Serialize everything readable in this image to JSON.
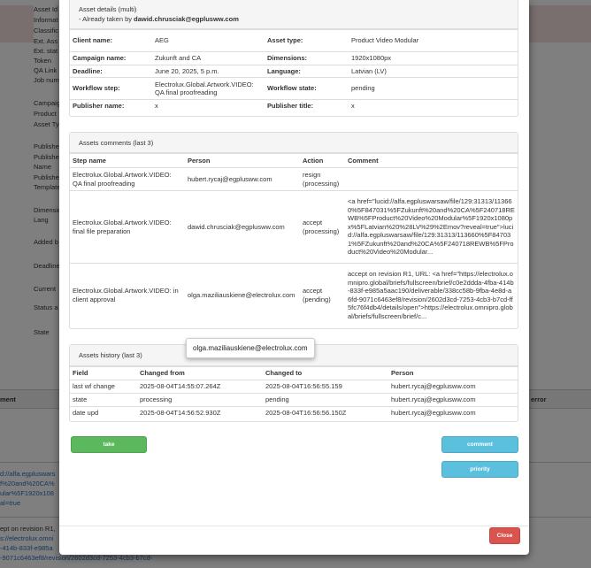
{
  "background": {
    "labels": [
      "Asset Id",
      "Informat",
      "Classific",
      "Ext. Ass",
      "Ext. stat",
      "Token",
      "QA Link",
      "Job num",
      "Campaig",
      "Product",
      "Asset Ty",
      "Publishe",
      "Publishe",
      "Name",
      "Publishe",
      "Template",
      "Dimensio",
      "Lang",
      "Added b",
      "Deadline",
      "Current",
      "Status a",
      "State"
    ],
    "table_headers": {
      "left": "ment",
      "right": "error"
    },
    "row1_lines": [
      "d://alfa.egpluswars",
      "f%20and%20CA%",
      "ular%5F1920x108",
      "al=true"
    ],
    "row2_lines": [
      "ept on revision R1,",
      "s://electrolux.omni",
      "-414b-833f-e985a",
      "-9071c6463ef8/revision/2602d3cd-7253-4cb3-b7cd-"
    ]
  },
  "details": {
    "title": "Asset details (multi)",
    "taken_prefix": "- Already taken by ",
    "taken_by": "dawid.chrusciak@egplusww.com",
    "rows": [
      {
        "k1": "Client name:",
        "v1": "AEG",
        "k2": "Asset type:",
        "v2": "Product Video Modular"
      },
      {
        "k1": "Campaign name:",
        "v1": "Zukunft and CA",
        "k2": "Dimensions:",
        "v2": "1920x1080px"
      },
      {
        "k1": "Deadline:",
        "v1": "June 20, 2025, 5 p.m.",
        "k2": "Language:",
        "v2": "Latvian (LV)"
      },
      {
        "k1": "Workflow step:",
        "v1": "Electrolux.Global.Artwork.VIDEO: QA final proofreading",
        "k2": "Workflow state:",
        "v2": "pending"
      },
      {
        "k1": "Publisher name:",
        "v1": "x",
        "k2": "Publisher title:",
        "v2": "x"
      }
    ]
  },
  "comments": {
    "title": "Assets comments (last 3)",
    "headers": [
      "Step name",
      "Person",
      "Action",
      "Comment"
    ],
    "rows": [
      {
        "step": "Electrolux.Global.Artwork.VIDEO: QA final proofreading",
        "person": "hubert.rycaj@egplusww.com",
        "action": "resign (processing)",
        "comment": ""
      },
      {
        "step": "Electrolux.Global.Artwork.VIDEO: final file preparation",
        "person": "dawid.chrusciak@egplusww.com",
        "action": "accept (processing)",
        "comment": "<a href=\"lucid://alfa.egpluswarsaw/file/129:31313/113660%5F847031%5FZukunft%20and%20CA%5F240718REWB%5FProduct%20Video%20Modular%5F1920x1080px%5FLatvian%20%28LV%29%2Emov?reveal=true\">lucid://alfa.egpluswarsaw/file/129:31313/113660%5F847031%5FZukunft%20and%20CA%5F240718REWB%5FProduct%20Video%20Modular..."
      },
      {
        "step": "Electrolux.Global.Artwork.VIDEO: in client approval",
        "person": "olga.maziliauskiene@electrolux.com",
        "action": "accept (pending)",
        "comment": "accept on revision R1, URL: <a href=\"https://electrolux.omnipro.global/briefs/fullscreen/brief/c0e2ddda-4fba-414b-833f-e985a5aac190/deliverable/338cc58b-9fba-4e8d-a6fd-9071c6463ef8/revision/2602d3cd-7253-4cb3-b7cd-ff5fc76f4db4/details/open\">https://electrolux.omnipro.global/briefs/fullscreen/brief/c..."
      }
    ]
  },
  "tooltip": "olga.maziliauskiene@electrolux.com",
  "history": {
    "title": "Assets history (last 3)",
    "headers": [
      "Field",
      "Changed from",
      "Changed to",
      "Person"
    ],
    "rows": [
      {
        "field": "last wf change",
        "from": "2025-08-04T14:55:07.264Z",
        "to": "2025-08-04T16:56:55.159",
        "person": "hubert.rycaj@egplusww.com"
      },
      {
        "field": "state",
        "from": "processing",
        "to": "pending",
        "person": "hubert.rycaj@egplusww.com"
      },
      {
        "field": "date upd",
        "from": "2025-08-04T14:56:52.930Z",
        "to": "2025-08-04T16:56:56.150Z",
        "person": "hubert.rycaj@egplusww.com"
      }
    ]
  },
  "buttons": {
    "take": "take",
    "comment": "comment",
    "priority": "priority",
    "close": "Close"
  },
  "colors": {
    "take": "#5cb85c",
    "comment": "#5bc0de",
    "close": "#d9534f"
  }
}
